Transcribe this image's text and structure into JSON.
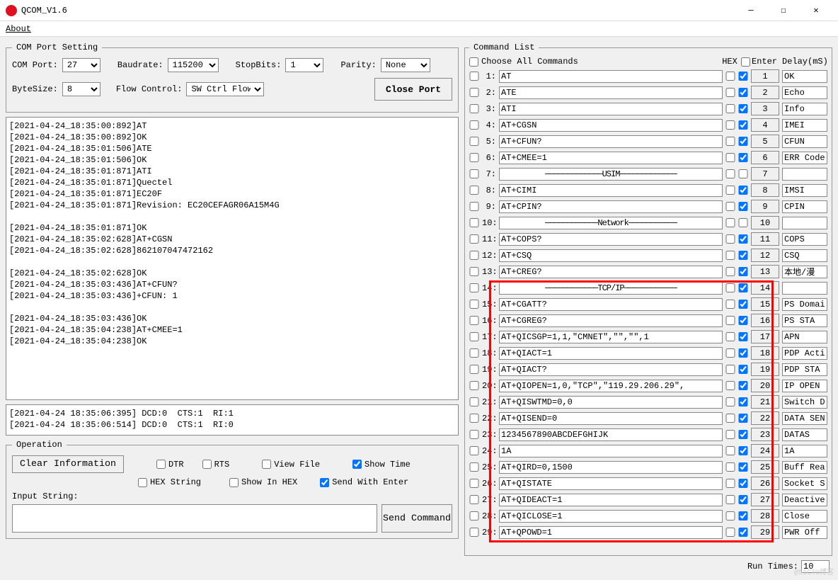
{
  "window": {
    "title": "QCOM_V1.6"
  },
  "menu": {
    "about": "About"
  },
  "com": {
    "legend": "COM Port Setting",
    "port_label": "COM Port:",
    "port_value": "27",
    "baud_label": "Baudrate:",
    "baud_value": "115200",
    "stop_label": "StopBits:",
    "stop_value": "1",
    "parity_label": "Parity:",
    "parity_value": "None",
    "byte_label": "ByteSize:",
    "byte_value": "8",
    "flow_label": "Flow Control:",
    "flow_value": "SW Ctrl Flow",
    "close_btn": "Close Port"
  },
  "log": {
    "lines": [
      "[2021-04-24_18:35:00:892]AT",
      "[2021-04-24_18:35:00:892]OK",
      "[2021-04-24_18:35:01:506]ATE",
      "[2021-04-24_18:35:01:506]OK",
      "[2021-04-24_18:35:01:871]ATI",
      "[2021-04-24_18:35:01:871]Quectel",
      "[2021-04-24_18:35:01:871]EC20F",
      "[2021-04-24_18:35:01:871]Revision: EC20CEFAGR06A15M4G",
      "",
      "[2021-04-24_18:35:01:871]OK",
      "[2021-04-24_18:35:02:628]AT+CGSN",
      "[2021-04-24_18:35:02:628]862107047472162",
      "",
      "[2021-04-24_18:35:02:628]OK",
      "[2021-04-24_18:35:03:436]AT+CFUN?",
      "[2021-04-24_18:35:03:436]+CFUN: 1",
      "",
      "[2021-04-24_18:35:03:436]OK",
      "[2021-04-24_18:35:04:238]AT+CMEE=1",
      "[2021-04-24_18:35:04:238]OK"
    ],
    "lines2": [
      "[2021-04-24 18:35:06:395] DCD:0  CTS:1  RI:1",
      "[2021-04-24 18:35:06:514] DCD:0  CTS:1  RI:0"
    ]
  },
  "operation": {
    "legend": "Operation",
    "clear_btn": "Clear Information",
    "dtr": "DTR",
    "rts": "RTS",
    "view_file": "View File",
    "show_time": "Show Time",
    "hex_string": "HEX String",
    "show_in_hex": "Show In HEX",
    "send_with_enter": "Send With Enter",
    "input_label": "Input String:",
    "send_btn": "Send Command"
  },
  "cmd": {
    "legend": "Command List",
    "choose_all": "Choose All Commands",
    "hex": "HEX",
    "enter": "Enter",
    "delay": "Delay(mS)",
    "run_times_label": "Run Times:",
    "run_times_value": "10",
    "rows": [
      {
        "n": "1",
        "cmd": "AT",
        "enter": true,
        "desc": "OK",
        "sep": false
      },
      {
        "n": "2",
        "cmd": "ATE",
        "enter": true,
        "desc": "Echo",
        "sep": false
      },
      {
        "n": "3",
        "cmd": "ATI",
        "enter": true,
        "desc": "Info",
        "sep": false
      },
      {
        "n": "4",
        "cmd": "AT+CGSN",
        "enter": true,
        "desc": "IMEI",
        "sep": false
      },
      {
        "n": "5",
        "cmd": "AT+CFUN?",
        "enter": true,
        "desc": "CFUN",
        "sep": false
      },
      {
        "n": "6",
        "cmd": "AT+CMEE=1",
        "enter": true,
        "desc": "ERR Code",
        "sep": false
      },
      {
        "n": "7",
        "cmd": "─────────────USIM─────────────",
        "enter": false,
        "desc": "",
        "sep": true
      },
      {
        "n": "8",
        "cmd": "AT+CIMI",
        "enter": true,
        "desc": "IMSI",
        "sep": false
      },
      {
        "n": "9",
        "cmd": "AT+CPIN?",
        "enter": true,
        "desc": "CPIN",
        "sep": false
      },
      {
        "n": "10",
        "cmd": "────────────Network───────────",
        "enter": false,
        "desc": "",
        "sep": true
      },
      {
        "n": "11",
        "cmd": "AT+COPS?",
        "enter": true,
        "desc": "COPS",
        "sep": false
      },
      {
        "n": "12",
        "cmd": "AT+CSQ",
        "enter": true,
        "desc": "CSQ",
        "sep": false
      },
      {
        "n": "13",
        "cmd": "AT+CREG?",
        "enter": true,
        "desc": "本地/漫",
        "sep": false
      },
      {
        "n": "14",
        "cmd": "────────────TCP/IP────────────",
        "enter": true,
        "desc": "",
        "sep": true
      },
      {
        "n": "15",
        "cmd": "AT+CGATT?",
        "enter": true,
        "desc": "PS Domai",
        "sep": false
      },
      {
        "n": "16",
        "cmd": "AT+CGREG?",
        "enter": true,
        "desc": "PS STA",
        "sep": false
      },
      {
        "n": "17",
        "cmd": "AT+QICSGP=1,1,\"CMNET\",\"\",\"\",1",
        "enter": true,
        "desc": "APN",
        "sep": false
      },
      {
        "n": "18",
        "cmd": "AT+QIACT=1",
        "enter": true,
        "desc": "PDP Acti",
        "sep": false
      },
      {
        "n": "19",
        "cmd": "AT+QIACT?",
        "enter": true,
        "desc": "PDP STA",
        "sep": false
      },
      {
        "n": "20",
        "cmd": "AT+QIOPEN=1,0,\"TCP\",\"119.29.206.29\",",
        "enter": true,
        "desc": "IP OPEN",
        "sep": false
      },
      {
        "n": "21",
        "cmd": "AT+QISWTMD=0,0",
        "enter": true,
        "desc": "Switch D",
        "sep": false
      },
      {
        "n": "22",
        "cmd": "AT+QISEND=0",
        "enter": true,
        "desc": "DATA SEN",
        "sep": false
      },
      {
        "n": "23",
        "cmd": "1234567890ABCDEFGHIJK",
        "enter": true,
        "desc": "DATAS",
        "sep": false
      },
      {
        "n": "24",
        "cmd": "1A",
        "enter": true,
        "desc": "1A",
        "sep": false
      },
      {
        "n": "25",
        "cmd": "AT+QIRD=0,1500",
        "enter": true,
        "desc": "Buff Rea",
        "sep": false
      },
      {
        "n": "26",
        "cmd": "AT+QISTATE",
        "enter": true,
        "desc": "Socket S",
        "sep": false
      },
      {
        "n": "27",
        "cmd": "AT+QIDEACT=1",
        "enter": true,
        "desc": "Deactive",
        "sep": false
      },
      {
        "n": "28",
        "cmd": "AT+QICLOSE=1",
        "enter": true,
        "desc": "Close",
        "sep": false
      },
      {
        "n": "29",
        "cmd": "AT+QPOWD=1",
        "enter": true,
        "desc": "PWR Off",
        "sep": false
      }
    ]
  }
}
